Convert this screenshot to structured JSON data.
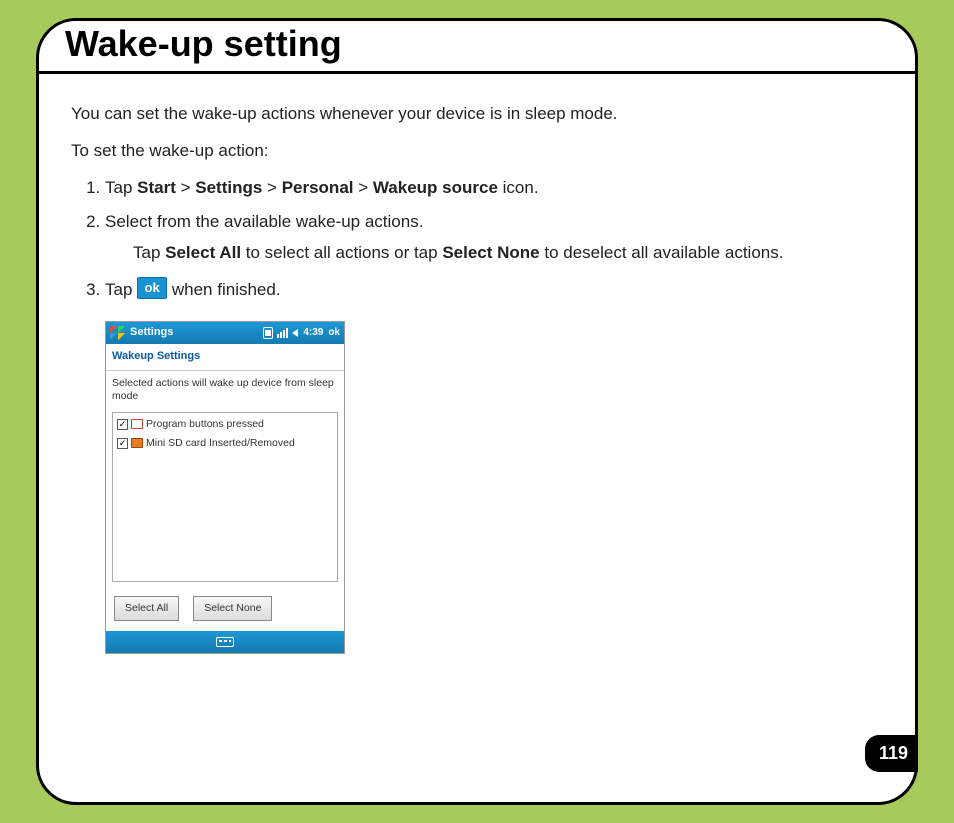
{
  "page": {
    "title": "Wake-up setting",
    "intro": "You can set the wake-up actions whenever your device is in sleep mode.",
    "lead": "To set the wake-up action:",
    "page_number": "119"
  },
  "steps": {
    "s1_pre": "Tap ",
    "s1_b1": "Start",
    "s1_sep": " > ",
    "s1_b2": "Settings",
    "s1_b3": "Personal",
    "s1_b4": "Wakeup source",
    "s1_post": " icon.",
    "s2": "Select from the available wake-up actions.",
    "s2_sub_pre": "Tap ",
    "s2_sub_b1": "Select All",
    "s2_sub_mid": " to select all actions or tap ",
    "s2_sub_b2": "Select None",
    "s2_sub_post": " to deselect all available actions.",
    "s3_pre": "Tap ",
    "s3_post": " when finished."
  },
  "ok_badge": "ok",
  "device": {
    "topbar_title": "Settings",
    "time": "4:39",
    "ok": "ok",
    "subtitle": "Wakeup Settings",
    "description": "Selected actions will wake up device from sleep mode",
    "items": [
      {
        "checked": "✓",
        "label": "Program buttons pressed"
      },
      {
        "checked": "✓",
        "label": "Mini SD card Inserted/Removed"
      }
    ],
    "btn_select_all": "Select All",
    "btn_select_none": "Select None"
  }
}
